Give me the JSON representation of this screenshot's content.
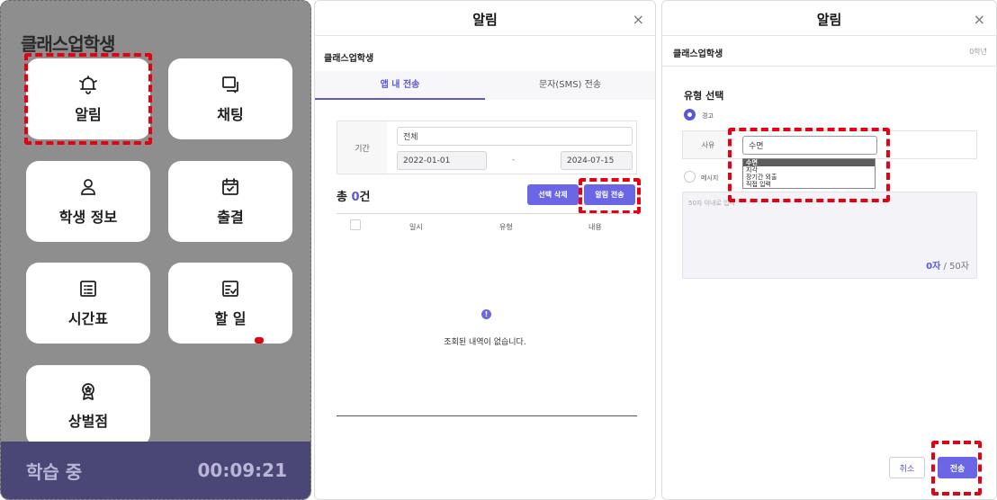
{
  "panel1": {
    "app_title": "클래스업학생",
    "tiles": [
      {
        "label": "알림",
        "icon": "bell-icon"
      },
      {
        "label": "채팅",
        "icon": "chat-icon"
      },
      {
        "label": "학생 정보",
        "icon": "user-icon"
      },
      {
        "label": "출결",
        "icon": "calendar-check-icon"
      },
      {
        "label": "시간표",
        "icon": "timetable-icon"
      },
      {
        "label": "할 일",
        "icon": "todo-icon"
      },
      {
        "label": "상벌점",
        "icon": "award-icon"
      }
    ],
    "status_label": "학습 중",
    "timer": "00:09:21"
  },
  "panel2": {
    "title": "알림",
    "close": "×",
    "org_name": "클래스업학생",
    "tabs": [
      "앱 내 전송",
      "문자(SMS) 전송"
    ],
    "filter": {
      "label": "기간",
      "select_value": "전체",
      "date_from": "2022-01-01",
      "separator": "-",
      "date_to": "2024-07-15"
    },
    "count_prefix": "총 ",
    "count_value": "0",
    "count_suffix": "건",
    "delete_button": "선택 삭제",
    "send_button": "알림 전송",
    "columns": [
      "일시",
      "유형",
      "내용"
    ],
    "empty_message": "조회된 내역이 없습니다."
  },
  "panel3": {
    "title": "알림",
    "close": "×",
    "org_name": "클래스업학생",
    "grade": "0학년",
    "section_title": "유형 선택",
    "radio_warning": "경고",
    "radio_message": "메시지",
    "reason_label": "사유",
    "reason_value": "수면",
    "reason_options": [
      "수면",
      "지각",
      "장기간 외출",
      "직접 입력"
    ],
    "textarea_placeholder": "50자 이내로 입력",
    "char_count": "0자",
    "char_limit": " / 50자",
    "cancel_button": "취소",
    "send_button": "전송"
  },
  "colors": {
    "accent": "#5b57d9",
    "highlight": "#e60012",
    "bottom_bar": "#4a4777"
  }
}
